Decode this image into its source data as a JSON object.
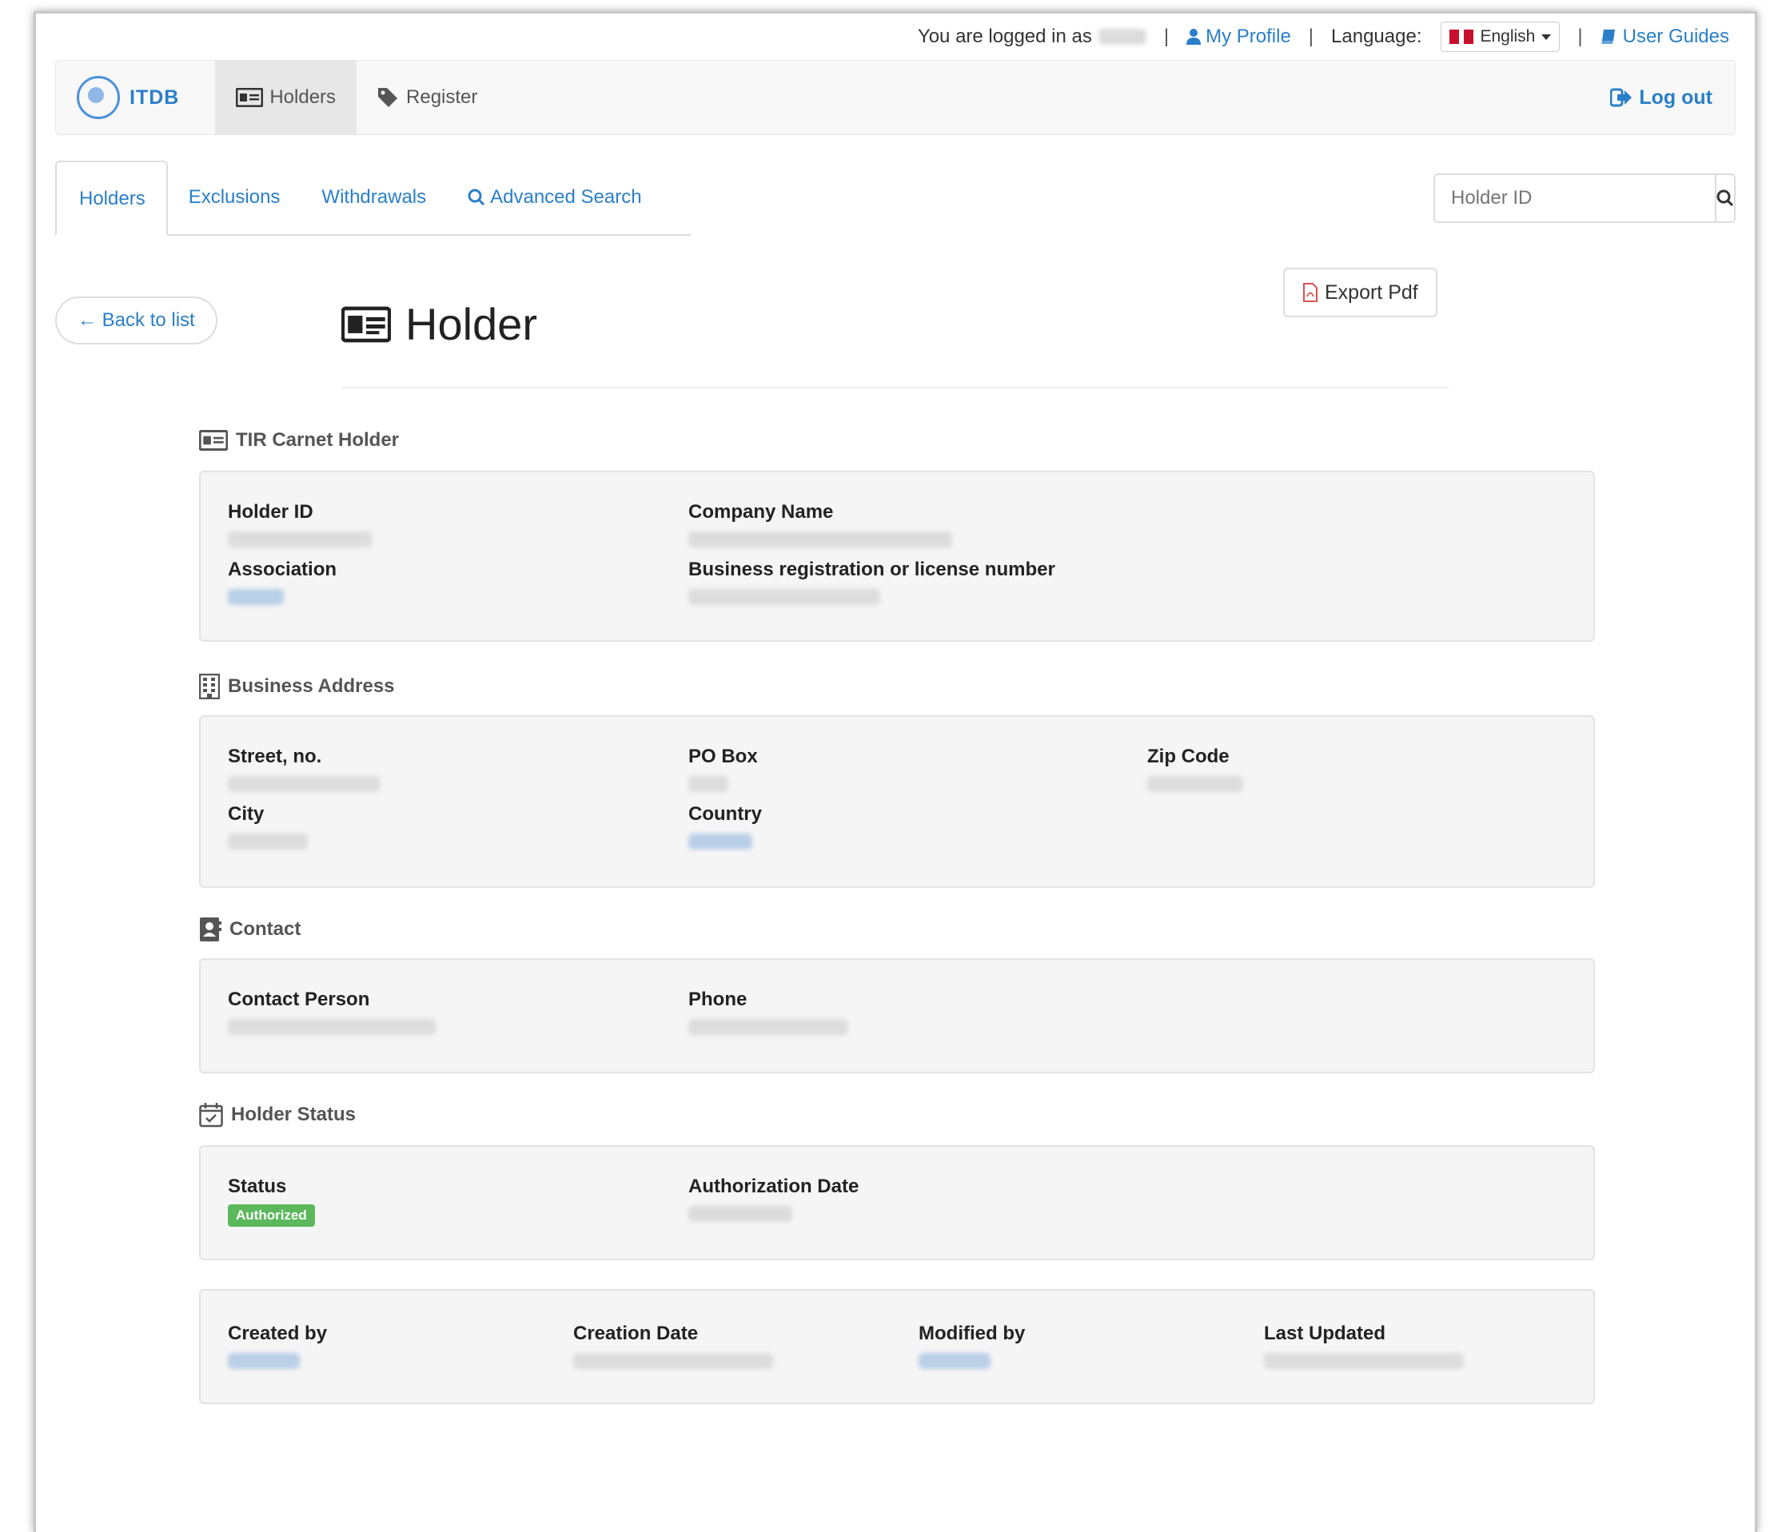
{
  "util": {
    "logged_in_text": "You are logged in as",
    "my_profile": "My Profile",
    "language_label": "Language:",
    "language_value": "English",
    "user_guides": "User Guides"
  },
  "navbar": {
    "brand": "ITDB",
    "items": [
      {
        "label": "Holders",
        "icon": "id-card-icon"
      },
      {
        "label": "Register",
        "icon": "tag-icon"
      }
    ],
    "logout": "Log out"
  },
  "tabs": [
    {
      "label": "Holders"
    },
    {
      "label": "Exclusions"
    },
    {
      "label": "Withdrawals"
    },
    {
      "label": "Advanced Search"
    }
  ],
  "search": {
    "placeholder": "Holder ID"
  },
  "page": {
    "back": "← Back to list",
    "title": "Holder",
    "export": "Export Pdf"
  },
  "sections": {
    "holder": {
      "title": "TIR Carnet Holder",
      "holder_id": "Holder ID",
      "company_name": "Company Name",
      "association": "Association",
      "business_reg": "Business registration or license number"
    },
    "address": {
      "title": "Business Address",
      "street": "Street, no.",
      "po_box": "PO Box",
      "zip": "Zip Code",
      "city": "City",
      "country": "Country"
    },
    "contact": {
      "title": "Contact",
      "person": "Contact Person",
      "phone": "Phone"
    },
    "status": {
      "title": "Holder Status",
      "status_label": "Status",
      "status_value": "Authorized",
      "auth_date": "Authorization Date"
    },
    "audit": {
      "created_by": "Created by",
      "creation_date": "Creation Date",
      "modified_by": "Modified by",
      "last_updated": "Last Updated"
    }
  },
  "colors": {
    "link": "#2a7fc9",
    "success": "#5cb85c",
    "well": "#f5f5f5"
  }
}
